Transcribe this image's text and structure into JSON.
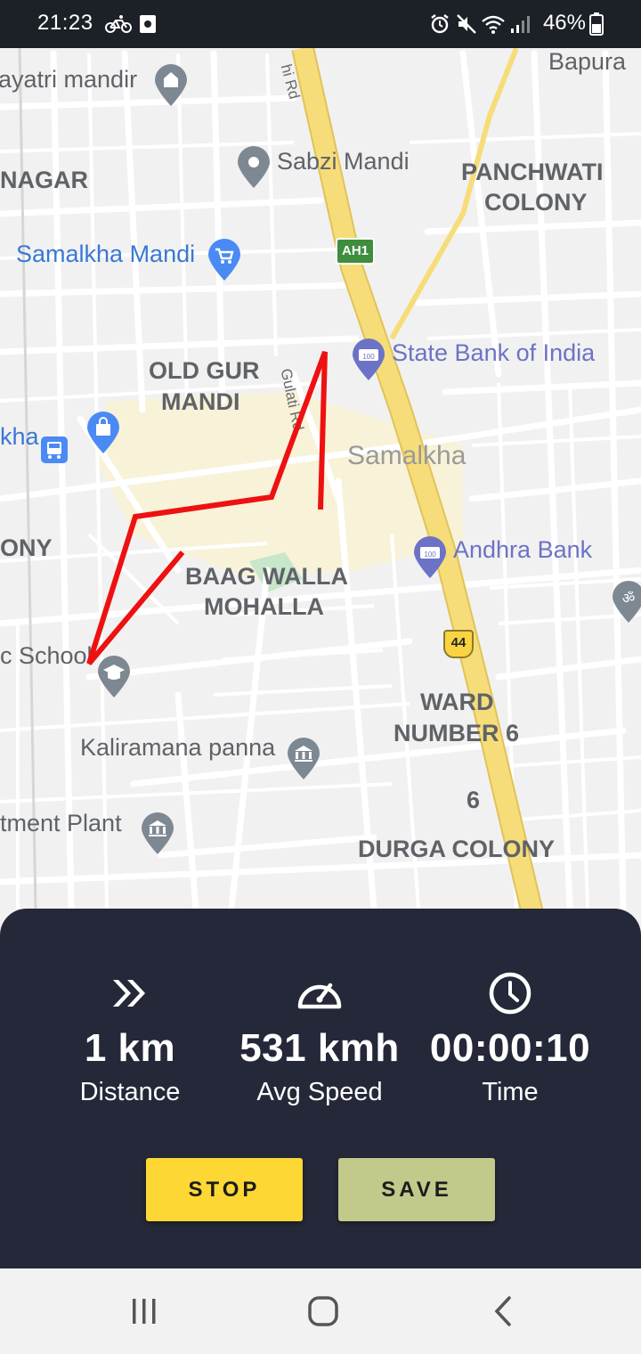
{
  "status_bar": {
    "time": "21:23",
    "battery": "46%",
    "icons": [
      "cycling-icon",
      "screenshot-icon",
      "alarm-icon",
      "mute-icon",
      "wifi-icon",
      "signal-icon",
      "battery-icon"
    ]
  },
  "map": {
    "labels": {
      "bapura": "Bapura",
      "gayatri": "ayatri mandir",
      "nagar": "NAGAR",
      "sabzi": "Sabzi Mandi",
      "panchwati1": "PANCHWATI",
      "panchwati2": "COLONY",
      "samalkha_mandi": "Samalkha Mandi",
      "old_gur1": "OLD GUR",
      "old_gur2": "MANDI",
      "state_bank": "State Bank of India",
      "kha": "kha",
      "samalkha": "Samalkha",
      "ony": "ONY",
      "andhra": "Andhra Bank",
      "baag1": "BAAG WALLA",
      "baag2": "MOHALLA",
      "school": "c School",
      "ward1": "WARD",
      "ward2": "NUMBER 6",
      "kaliramana": "Kaliramana panna",
      "six": "6",
      "plant": "tment Plant",
      "durga": "DURGA COLONY",
      "delhi_rd": "hi Rd",
      "gulati_rd": "Gulati Rd",
      "ah1": "AH1",
      "nh44": "44"
    },
    "route_color": "#ee1111"
  },
  "stats": {
    "distance": {
      "value": "1 km",
      "label": "Distance",
      "icon": "fast-forward-icon"
    },
    "speed": {
      "value": "531 kmh",
      "label": "Avg Speed",
      "icon": "speedometer-icon"
    },
    "time": {
      "value": "00:00:10",
      "label": "Time",
      "icon": "clock-icon"
    }
  },
  "buttons": {
    "stop": "STOP",
    "save": "SAVE"
  },
  "colors": {
    "panel": "#242838",
    "stop": "#fdd835",
    "save": "#c3c98a",
    "highway": "#f6dd79"
  }
}
